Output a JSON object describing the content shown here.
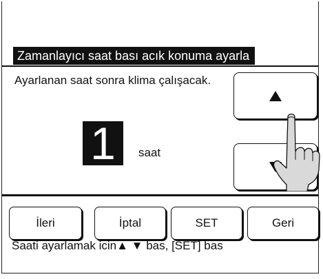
{
  "header": {
    "title": "Zamanlayıcı saat bası acık konuma ayarla"
  },
  "instruction": "Ayarlanan saat sonra klima çalışacak.",
  "setting": {
    "value": "1",
    "unit": "saat"
  },
  "arrows": {
    "up_icon": "triangle-up-icon",
    "down_icon": "triangle-down-icon"
  },
  "buttons": {
    "next": "İleri",
    "cancel": "İptal",
    "set": "SET",
    "back": "Geri"
  },
  "hint": "Saati ayarlamak icin▲ ▼ bas, [SET] bas"
}
